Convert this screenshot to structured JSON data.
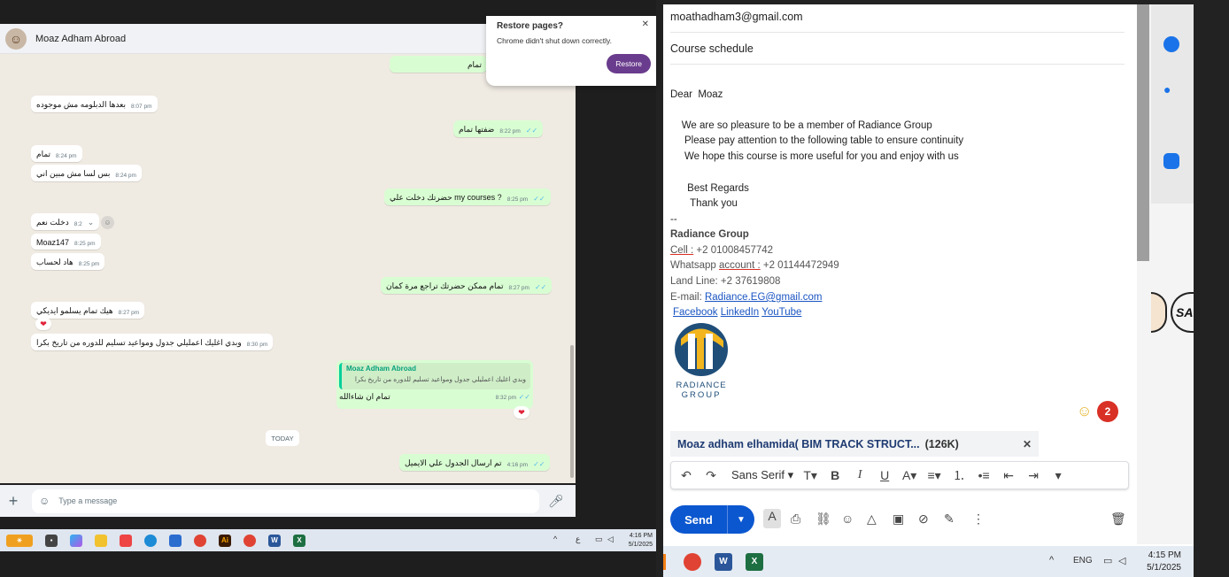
{
  "whatsapp": {
    "contact_name": "Moaz Adham Abroad",
    "input_placeholder": "Type a message",
    "today_label": "TODAY",
    "messages": [
      {
        "text": "تمام",
        "time": "",
        "dir": "out"
      },
      {
        "text": "بعدها الدبلومه مش موجوده",
        "time": "8:07 pm",
        "dir": "in"
      },
      {
        "text": "ضفتها تمام",
        "time": "8:22 pm",
        "dir": "out"
      },
      {
        "text": "تمام",
        "time": "8:24 pm",
        "dir": "in"
      },
      {
        "text": "بس لسا مش مبين اني",
        "time": "8:24 pm",
        "dir": "in"
      },
      {
        "text": "حضرتك دخلت علي my courses ?",
        "time": "8:25 pm",
        "dir": "out"
      },
      {
        "text": "دخلت نعم",
        "time": "8:2",
        "dir": "in"
      },
      {
        "text": "Moaz147",
        "time": "8:25 pm",
        "dir": "in"
      },
      {
        "text": "هاد لحساب",
        "time": "8:25 pm",
        "dir": "in"
      },
      {
        "text": "تمام ممكن حضرتك تراجع مرة كمان",
        "time": "8:27 pm",
        "dir": "out"
      },
      {
        "text": "هيك تمام يسلمو ايديكي",
        "time": "8:27 pm",
        "dir": "in"
      },
      {
        "text": "وبدي اغليك اعمليلي جدول ومواعيد تسليم للدوره من تاريخ بكرا",
        "time": "8:30 pm",
        "dir": "in"
      },
      {
        "quote_author": "Moaz Adham Abroad",
        "quote_text": "وبدي اغليك اعمليلي جدول ومواعيد تسليم للدوره من تاريخ بكرا",
        "text": "تمام ان شاءالله",
        "time": "8:32 pm",
        "dir": "out"
      },
      {
        "text": "تم ارسال الجدول علي الايميل",
        "time": "4:16 pm",
        "dir": "out"
      }
    ],
    "reaction": "❤"
  },
  "chrome_popup": {
    "title": "Restore pages?",
    "desc": "Chrome didn't shut down correctly.",
    "button": "Restore"
  },
  "left_taskbar": {
    "time": "4:16 PM",
    "date": "5/1/2025",
    "lang": "ع"
  },
  "email": {
    "to": "moathadham3@gmail.com",
    "subject": "Course schedule",
    "greeting": "Dear  Moaz",
    "lines": [
      "    We are so pleasure to be a member of Radiance Group",
      "     Please pay attention to the following table to ensure continuity",
      "     We hope this course is more useful for you and enjoy with us"
    ],
    "regards": "      Best Regards",
    "thanks": "       Thank you",
    "sig_sep": "--",
    "company": "Radiance Group",
    "cell_label": "Cell :",
    "cell": " +2 01008457742",
    "whatsapp_label": "Whatsapp ",
    "account_label": "account :",
    "whatsapp": " +2 01144472949",
    "landline": "Land Line: +2 37619808",
    "email_label": "E-mail: ",
    "email_addr": "Radiance.EG@gmail.com",
    "social": [
      "Facebook",
      "LinkedIn",
      "YouTube"
    ],
    "logo_text_1": "RADIANCE",
    "logo_text_2": "GROUP",
    "attachment_name": "Moaz adham elhamida( BIM TRACK STRUCT...",
    "attachment_size": "(126K)",
    "font": "Sans Serif",
    "send_label": "Send",
    "emoji_count": "2"
  },
  "right_taskbar": {
    "lang": "ENG",
    "time": "4:15 PM",
    "date": "5/1/2025"
  },
  "colors": {
    "wa_out": "#d9fdd3",
    "wa_bg": "#efeae2",
    "send_blue": "#0b57d0",
    "link": "#1a55c2"
  }
}
